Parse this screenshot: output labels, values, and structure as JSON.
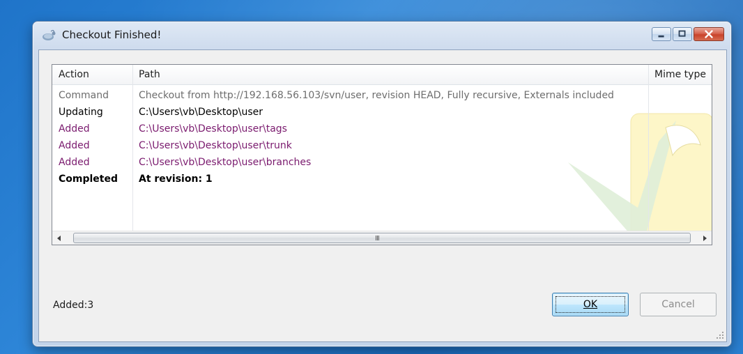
{
  "window": {
    "title": "Checkout Finished!",
    "caption_buttons": [
      "minimize-icon",
      "maximize-icon",
      "close-icon"
    ]
  },
  "table": {
    "columns": [
      "Action",
      "Path",
      "Mime type"
    ],
    "rows": [
      {
        "action": "Command",
        "path": "Checkout from http://192.168.56.103/svn/user, revision HEAD, Fully recursive, Externals included"
      },
      {
        "action": "Updating",
        "path": "C:\\Users\\vb\\Desktop\\user"
      },
      {
        "action": "Added",
        "path": "C:\\Users\\vb\\Desktop\\user\\tags"
      },
      {
        "action": "Added",
        "path": "C:\\Users\\vb\\Desktop\\user\\trunk"
      },
      {
        "action": "Added",
        "path": "C:\\Users\\vb\\Desktop\\user\\branches"
      },
      {
        "action": "Completed",
        "path": "At revision: 1"
      }
    ],
    "scroll_grip": "III"
  },
  "status": {
    "text": "Added:3"
  },
  "buttons": {
    "ok": "OK",
    "cancel": "Cancel"
  },
  "colors": {
    "command_text": "#6d6d6d",
    "added_text": "#7a1a6e",
    "accent": "#3c7fb1"
  }
}
